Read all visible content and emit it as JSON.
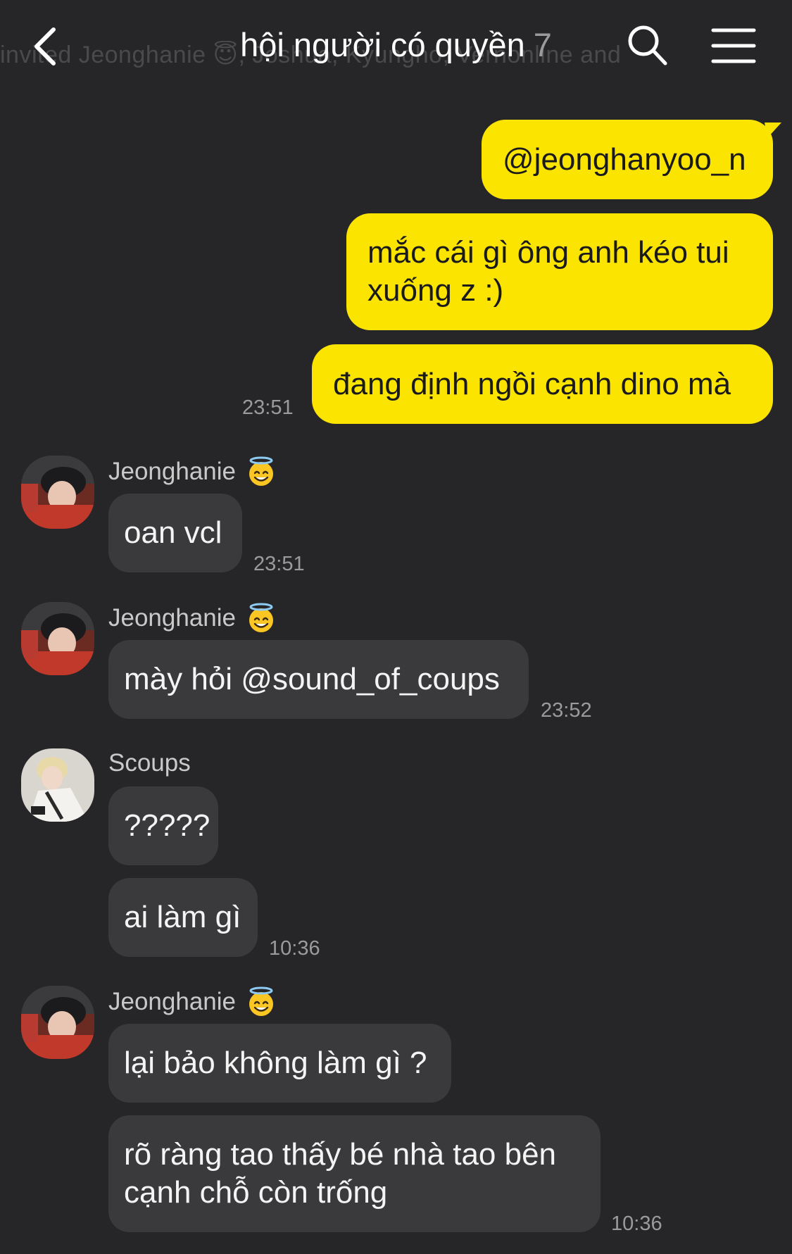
{
  "header": {
    "title": "hội người có quyền",
    "member_count": "7",
    "subtitle": "invited Jeonghanie 😇, Joshua, Kyungho, Vernonline and"
  },
  "messages": [
    {
      "from": "me",
      "text": "@jeonghanyoo_n"
    },
    {
      "from": "me",
      "text": "mắc cái gì ông anh kéo tui xuống z :)"
    },
    {
      "from": "me",
      "text": "đang định ngồi cạnh dino mà",
      "time": "23:51"
    },
    {
      "from": "Jeonghanie",
      "text": "oan vcl",
      "time": "23:51"
    },
    {
      "from": "Jeonghanie",
      "text": "mày hỏi @sound_of_coups",
      "time": "23:52"
    },
    {
      "from": "Scoups",
      "text": "?????"
    },
    {
      "from": "Scoups",
      "text": "ai làm gì",
      "time": "10:36"
    },
    {
      "from": "Jeonghanie",
      "text": "lại bảo không làm gì ?"
    },
    {
      "from": "Jeonghanie",
      "text": "rõ ràng tao thấy bé nhà tao bên cạnh chỗ còn trống",
      "time": "10:36"
    }
  ],
  "senders": {
    "jeonghanie": {
      "name": "Jeonghanie",
      "badge_icon": "smiling-face-with-halo-icon"
    },
    "scoups": {
      "name": "Scoups"
    }
  },
  "colors": {
    "background": "#262628",
    "my_bubble": "#fbe400",
    "their_bubble": "#3a3a3c"
  },
  "icons": {
    "back": "chevron-left-icon",
    "search": "search-icon",
    "menu": "hamburger-menu-icon"
  }
}
